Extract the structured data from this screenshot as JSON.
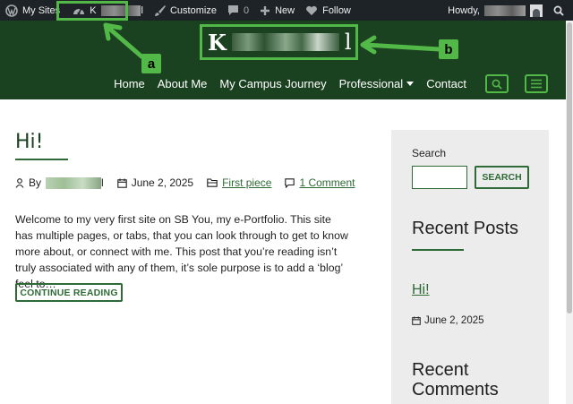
{
  "adminbar": {
    "my_sites": "My Sites",
    "site_letter": "K",
    "site_tail": "l",
    "customize": "Customize",
    "comments_count": "0",
    "new": "New",
    "follow": "Follow",
    "howdy": "Howdy,",
    "icons": [
      "wordpress-icon",
      "dashboard-icon",
      "brush-icon",
      "comment-icon",
      "plus-icon",
      "heart-icon",
      "avatar",
      "search-icon"
    ]
  },
  "header": {
    "logo_letter": "K",
    "logo_tail": "l",
    "nav": [
      "Home",
      "About Me",
      "My Campus Journey",
      "Professional",
      "Contact"
    ],
    "icons": [
      "search-icon",
      "menu-icon"
    ]
  },
  "annotations": {
    "a": "a",
    "b": "b"
  },
  "post": {
    "title": "Hi!",
    "by": "By",
    "author_tail": "l",
    "date": "June 2, 2025",
    "category": "First piece",
    "comments": "1 Comment",
    "excerpt": "Welcome to my very first site on SB You, my e-Portfolio. This site has multiple pages, or tabs, that you can look through to get to know more about, or connect with me. This post that you’re reading isn’t truly associated with any of them, it’s sole purpose is to add a ‘blog’ feel to…",
    "continue": "CONTINUE READING"
  },
  "sidebar": {
    "search_label": "Search",
    "search_button": "SEARCH",
    "recent_posts": "Recent Posts",
    "recent_post_title": "Hi!",
    "recent_post_date": "June 2, 2025",
    "recent_comments": "Recent Comments"
  },
  "colors": {
    "header_bg": "#1b4220",
    "accent": "#52b848",
    "link": "#2e6a35",
    "adminbar_bg": "#1d2327"
  }
}
